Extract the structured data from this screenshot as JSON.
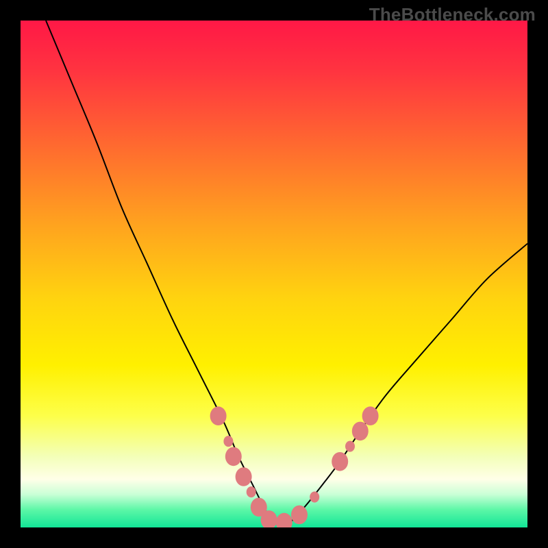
{
  "watermark": "TheBottleneck.com",
  "chart_data": {
    "type": "line",
    "title": "",
    "xlabel": "",
    "ylabel": "",
    "xlim": [
      0,
      100
    ],
    "ylim": [
      0,
      100
    ],
    "grid": false,
    "legend": false,
    "background_gradient_stops": [
      {
        "offset": 0.0,
        "color": "#ff1846"
      },
      {
        "offset": 0.1,
        "color": "#ff3440"
      },
      {
        "offset": 0.25,
        "color": "#ff6b2f"
      },
      {
        "offset": 0.4,
        "color": "#ffa21f"
      },
      {
        "offset": 0.55,
        "color": "#ffd40f"
      },
      {
        "offset": 0.68,
        "color": "#fff000"
      },
      {
        "offset": 0.78,
        "color": "#fdff4a"
      },
      {
        "offset": 0.86,
        "color": "#f3ffb8"
      },
      {
        "offset": 0.905,
        "color": "#ffffe8"
      },
      {
        "offset": 0.935,
        "color": "#c9ffd6"
      },
      {
        "offset": 0.965,
        "color": "#5cf7a7"
      },
      {
        "offset": 1.0,
        "color": "#12e597"
      }
    ],
    "series": [
      {
        "name": "bottleneck-curve",
        "x": [
          5,
          10,
          15,
          20,
          25,
          30,
          35,
          40,
          43,
          46,
          48,
          50,
          53,
          56,
          60,
          63,
          67,
          72,
          78,
          85,
          92,
          100
        ],
        "y": [
          100,
          88,
          76,
          63,
          52,
          41,
          31,
          21,
          14,
          8,
          4,
          1,
          1,
          4,
          9,
          13,
          19,
          26,
          33,
          41,
          49,
          56
        ],
        "color": "#000000",
        "stroke_width": 2
      }
    ],
    "markers": {
      "name": "highlight-dots",
      "color": "#df7b7f",
      "radius_primary": 12,
      "radius_secondary": 7,
      "points": [
        {
          "x": 39,
          "y": 22,
          "r": "primary"
        },
        {
          "x": 41,
          "y": 17,
          "r": "secondary"
        },
        {
          "x": 42,
          "y": 14,
          "r": "primary"
        },
        {
          "x": 44,
          "y": 10,
          "r": "primary"
        },
        {
          "x": 45.5,
          "y": 7,
          "r": "secondary"
        },
        {
          "x": 47,
          "y": 4,
          "r": "primary"
        },
        {
          "x": 49,
          "y": 1.5,
          "r": "primary"
        },
        {
          "x": 52,
          "y": 1,
          "r": "primary"
        },
        {
          "x": 55,
          "y": 2.5,
          "r": "primary"
        },
        {
          "x": 58,
          "y": 6,
          "r": "secondary"
        },
        {
          "x": 63,
          "y": 13,
          "r": "primary"
        },
        {
          "x": 65,
          "y": 16,
          "r": "secondary"
        },
        {
          "x": 67,
          "y": 19,
          "r": "primary"
        },
        {
          "x": 69,
          "y": 22,
          "r": "primary"
        }
      ]
    }
  }
}
